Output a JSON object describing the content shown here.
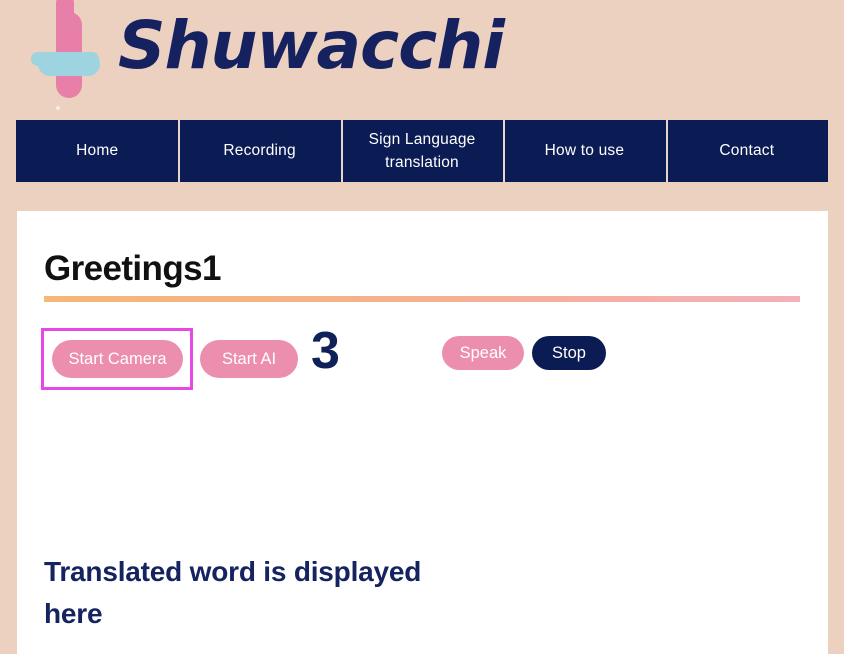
{
  "brand": {
    "name": "Shuwacchi",
    "logo_mark": "plus-cross-logo",
    "colors": {
      "pink": "#e87fa8",
      "blue": "#9ed4e0",
      "navy": "#162260",
      "background": "#ecd0c0"
    }
  },
  "nav": {
    "items": [
      {
        "label": "Home",
        "name": "nav-item-home"
      },
      {
        "label": "Recording",
        "name": "nav-item-recording"
      },
      {
        "label": "Sign Language translation",
        "name": "nav-item-sign-language-translation"
      },
      {
        "label": "How to use",
        "name": "nav-item-how-to-use"
      },
      {
        "label": "Contact",
        "name": "nav-item-contact"
      }
    ]
  },
  "main": {
    "title": "Greetings1",
    "controls": {
      "start_camera_label": "Start Camera",
      "start_ai_label": "Start AI",
      "counter": "3",
      "speak_label": "Speak",
      "stop_label": "Stop"
    },
    "output": {
      "translated_text": "Translated word is displayed here"
    }
  },
  "state": {
    "focused_element": "start-camera-button",
    "focus_outline_color": "#e648e6"
  }
}
